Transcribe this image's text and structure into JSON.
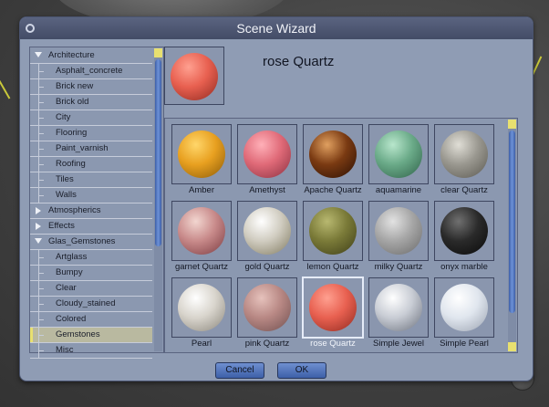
{
  "dialog": {
    "title": "Scene Wizard",
    "selected_material": "rose Quartz",
    "buttons": {
      "cancel": "Cancel",
      "ok": "OK"
    }
  },
  "tree": {
    "items": [
      {
        "label": "Architecture",
        "kind": "category",
        "expanded": true
      },
      {
        "label": "Asphalt_concrete",
        "kind": "item"
      },
      {
        "label": "Brick new",
        "kind": "item"
      },
      {
        "label": "Brick old",
        "kind": "item"
      },
      {
        "label": "City",
        "kind": "item"
      },
      {
        "label": "Flooring",
        "kind": "item"
      },
      {
        "label": "Paint_varnish",
        "kind": "item"
      },
      {
        "label": "Roofing",
        "kind": "item"
      },
      {
        "label": "Tiles",
        "kind": "item"
      },
      {
        "label": "Walls",
        "kind": "item"
      },
      {
        "label": "Atmospherics",
        "kind": "category",
        "expanded": false
      },
      {
        "label": "Effects",
        "kind": "category",
        "expanded": false
      },
      {
        "label": "Glas_Gemstones",
        "kind": "category",
        "expanded": true
      },
      {
        "label": "Artglass",
        "kind": "item"
      },
      {
        "label": "Bumpy",
        "kind": "item"
      },
      {
        "label": "Clear",
        "kind": "item"
      },
      {
        "label": "Cloudy_stained",
        "kind": "item"
      },
      {
        "label": "Colored",
        "kind": "item"
      },
      {
        "label": "Gemstones",
        "kind": "item",
        "selected": true
      },
      {
        "label": "Misc",
        "kind": "item"
      }
    ]
  },
  "materials": [
    {
      "label": "Amber",
      "color": "#e8a020",
      "hi": "#ffd66a",
      "shade": "#8a5a08"
    },
    {
      "label": "Amethyst",
      "color": "#e06a78",
      "hi": "#ffb0b8",
      "shade": "#8a3040"
    },
    {
      "label": "Apache Quartz",
      "color": "#7a3a12",
      "hi": "#e0a060",
      "shade": "#2a1004"
    },
    {
      "label": "aquamarine",
      "color": "#6aaa88",
      "hi": "#b8e6cc",
      "shade": "#2e6048"
    },
    {
      "label": "clear Quartz",
      "color": "#9a9890",
      "hi": "#e0ded6",
      "shade": "#5a5850"
    },
    {
      "label": "garnet Quartz",
      "color": "#c88a8a",
      "hi": "#f2d6d0",
      "shade": "#7a3a40"
    },
    {
      "label": "gold Quartz",
      "color": "#d0ccc0",
      "hi": "#ffffff",
      "shade": "#807a60"
    },
    {
      "label": "lemon Quartz",
      "color": "#7a7a38",
      "hi": "#b8b870",
      "shade": "#3e3e18"
    },
    {
      "label": "milky Quartz",
      "color": "#a6a6a6",
      "hi": "#e2e2e2",
      "shade": "#6a6a6a"
    },
    {
      "label": "onyx marble",
      "color": "#2a2a2a",
      "hi": "#707070",
      "shade": "#0a0a0a"
    },
    {
      "label": "Pearl",
      "color": "#d8d4cc",
      "hi": "#ffffff",
      "shade": "#8a867c"
    },
    {
      "label": "pink Quartz",
      "color": "#b88884",
      "hi": "#e6c2bc",
      "shade": "#705050"
    },
    {
      "label": "rose Quartz",
      "color": "#e86050",
      "hi": "#ffa090",
      "shade": "#902a20",
      "selected": true
    },
    {
      "label": "Simple Jewel",
      "color": "#c8ccd4",
      "hi": "#ffffff",
      "shade": "#6a707c"
    },
    {
      "label": "Simple Pearl",
      "color": "#e0e6ee",
      "hi": "#ffffff",
      "shade": "#9aa2b0"
    }
  ],
  "preview": {
    "color": "#e86050",
    "hi": "#ffa090",
    "shade": "#902a20"
  },
  "colors": {
    "accent_yellow": "#e8e070",
    "scroll_blue": "#4f72bc",
    "dialog_bg": "#8f9cb4"
  }
}
